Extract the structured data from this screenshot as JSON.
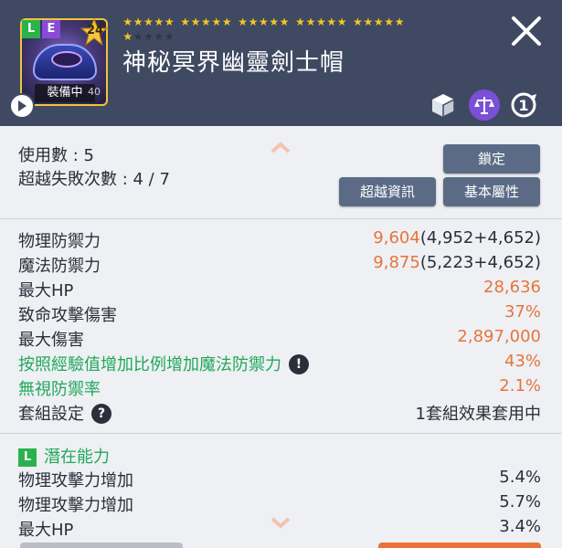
{
  "header": {
    "title": "神秘冥界幽靈劍士帽",
    "badge_l": "L",
    "badge_e": "E",
    "level": "24",
    "equipped_label": "裝備中",
    "equipped_level": "40",
    "stars": {
      "total": 30,
      "filled": 26
    },
    "icons": [
      "close-icon",
      "play-icon",
      "cube-icon",
      "scale-icon",
      "star-force-icon"
    ],
    "colors": {
      "header_bg": "#3f4a62",
      "star": "#f7c325",
      "accent_orange": "#e8743b",
      "accent_green": "#20a85a",
      "button": "#5b6b86"
    }
  },
  "info": {
    "uses": "使用數 : 5",
    "fail_count": "超越失敗次數 : 4 / 7",
    "buttons": {
      "lock": "鎖定",
      "transcend_info": "超越資訊",
      "base_stats": "基本屬性"
    }
  },
  "stats": [
    {
      "label": "物理防禦力",
      "value": "9,604",
      "detail": "(4,952+4,652)"
    },
    {
      "label": "魔法防禦力",
      "value": "9,875",
      "detail": "(5,223+4,652)"
    },
    {
      "label": "最大HP",
      "value": "28,636",
      "detail": ""
    },
    {
      "label": "致命攻擊傷害",
      "value": "37%",
      "detail": ""
    },
    {
      "label": "最大傷害",
      "value": "2,897,000",
      "detail": ""
    },
    {
      "label": "按照經驗值增加比例增加魔法防禦力",
      "value": "43%",
      "detail": ""
    },
    {
      "label": "無視防禦率",
      "value": "2.1%",
      "detail": ""
    },
    {
      "label": "套組設定",
      "value": "1套組效果套用中",
      "detail": ""
    }
  ],
  "potential": {
    "grade": "L",
    "title": "潛在能力",
    "lines": [
      {
        "label": "物理攻擊力增加",
        "value": "5.4%"
      },
      {
        "label": "物理攻擊力增加",
        "value": "5.7%"
      },
      {
        "label": "最大HP",
        "value": "3.4%"
      }
    ]
  },
  "help_mark": "?",
  "info_mark": "!"
}
